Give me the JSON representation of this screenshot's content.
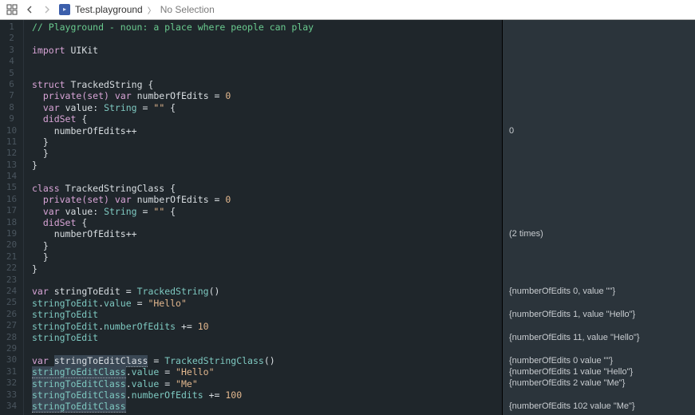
{
  "toolbar": {
    "file": "Test.playground",
    "selection": "No Selection"
  },
  "gutter": {
    "start": 1,
    "end": 34
  },
  "code": [
    {
      "n": 1,
      "tokens": [
        {
          "t": "// Playground - noun: a place where people can play",
          "c": "comment"
        }
      ]
    },
    {
      "n": 2,
      "tokens": []
    },
    {
      "n": 3,
      "tokens": [
        {
          "t": "import",
          "c": "key"
        },
        {
          "t": " "
        },
        {
          "t": "UIKit",
          "c": "id"
        }
      ]
    },
    {
      "n": 4,
      "tokens": []
    },
    {
      "n": 5,
      "tokens": []
    },
    {
      "n": 6,
      "tokens": [
        {
          "t": "struct",
          "c": "key"
        },
        {
          "t": " "
        },
        {
          "t": "TrackedString",
          "c": "id"
        },
        {
          "t": " {",
          "c": "punc"
        }
      ]
    },
    {
      "n": 7,
      "tokens": [
        {
          "t": "  "
        },
        {
          "t": "private(set)",
          "c": "key"
        },
        {
          "t": " "
        },
        {
          "t": "var",
          "c": "key"
        },
        {
          "t": " "
        },
        {
          "t": "numberOfEdits",
          "c": "id"
        },
        {
          "t": " = ",
          "c": "punc"
        },
        {
          "t": "0",
          "c": "num"
        }
      ]
    },
    {
      "n": 8,
      "tokens": [
        {
          "t": "  "
        },
        {
          "t": "var",
          "c": "key"
        },
        {
          "t": " "
        },
        {
          "t": "value",
          "c": "id"
        },
        {
          "t": ": ",
          "c": "punc"
        },
        {
          "t": "String",
          "c": "type"
        },
        {
          "t": " = ",
          "c": "punc"
        },
        {
          "t": "\"\"",
          "c": "str"
        },
        {
          "t": " {",
          "c": "punc"
        }
      ]
    },
    {
      "n": 9,
      "tokens": [
        {
          "t": "  "
        },
        {
          "t": "didSet",
          "c": "key"
        },
        {
          "t": " {",
          "c": "punc"
        }
      ]
    },
    {
      "n": 10,
      "tokens": [
        {
          "t": "    numberOfEdits++",
          "c": "id"
        }
      ]
    },
    {
      "n": 11,
      "tokens": [
        {
          "t": "  }",
          "c": "punc"
        }
      ]
    },
    {
      "n": 12,
      "tokens": [
        {
          "t": "  }",
          "c": "punc"
        }
      ]
    },
    {
      "n": 13,
      "tokens": [
        {
          "t": "}",
          "c": "punc"
        }
      ]
    },
    {
      "n": 14,
      "tokens": []
    },
    {
      "n": 15,
      "tokens": [
        {
          "t": "class",
          "c": "key"
        },
        {
          "t": " "
        },
        {
          "t": "TrackedStringClass",
          "c": "id"
        },
        {
          "t": " {",
          "c": "punc"
        }
      ]
    },
    {
      "n": 16,
      "tokens": [
        {
          "t": "  "
        },
        {
          "t": "private(set)",
          "c": "key"
        },
        {
          "t": " "
        },
        {
          "t": "var",
          "c": "key"
        },
        {
          "t": " "
        },
        {
          "t": "numberOfEdits",
          "c": "id"
        },
        {
          "t": " = ",
          "c": "punc"
        },
        {
          "t": "0",
          "c": "num"
        }
      ]
    },
    {
      "n": 17,
      "tokens": [
        {
          "t": "  "
        },
        {
          "t": "var",
          "c": "key"
        },
        {
          "t": " "
        },
        {
          "t": "value",
          "c": "id"
        },
        {
          "t": ": ",
          "c": "punc"
        },
        {
          "t": "String",
          "c": "type"
        },
        {
          "t": " = ",
          "c": "punc"
        },
        {
          "t": "\"\"",
          "c": "str"
        },
        {
          "t": " {",
          "c": "punc"
        }
      ]
    },
    {
      "n": 18,
      "tokens": [
        {
          "t": "  "
        },
        {
          "t": "didSet",
          "c": "key"
        },
        {
          "t": " {",
          "c": "punc"
        }
      ]
    },
    {
      "n": 19,
      "tokens": [
        {
          "t": "    numberOfEdits++",
          "c": "id"
        }
      ]
    },
    {
      "n": 20,
      "tokens": [
        {
          "t": "  }",
          "c": "punc"
        }
      ]
    },
    {
      "n": 21,
      "tokens": [
        {
          "t": "  }",
          "c": "punc"
        }
      ]
    },
    {
      "n": 22,
      "tokens": [
        {
          "t": "}",
          "c": "punc"
        }
      ]
    },
    {
      "n": 23,
      "tokens": []
    },
    {
      "n": 24,
      "tokens": [
        {
          "t": "var",
          "c": "key"
        },
        {
          "t": " "
        },
        {
          "t": "stringToEdit",
          "c": "id"
        },
        {
          "t": " = ",
          "c": "punc"
        },
        {
          "t": "TrackedString",
          "c": "type"
        },
        {
          "t": "()",
          "c": "punc"
        }
      ]
    },
    {
      "n": 25,
      "tokens": [
        {
          "t": "stringToEdit",
          "c": "type"
        },
        {
          "t": ".",
          "c": "punc"
        },
        {
          "t": "value",
          "c": "type"
        },
        {
          "t": " = ",
          "c": "punc"
        },
        {
          "t": "\"Hello\"",
          "c": "str"
        }
      ]
    },
    {
      "n": 26,
      "tokens": [
        {
          "t": "stringToEdit",
          "c": "type"
        }
      ]
    },
    {
      "n": 27,
      "tokens": [
        {
          "t": "stringToEdit",
          "c": "type"
        },
        {
          "t": ".",
          "c": "punc"
        },
        {
          "t": "numberOfEdits",
          "c": "type"
        },
        {
          "t": " += ",
          "c": "punc"
        },
        {
          "t": "10",
          "c": "num"
        }
      ]
    },
    {
      "n": 28,
      "tokens": [
        {
          "t": "stringToEdit",
          "c": "type"
        }
      ]
    },
    {
      "n": 29,
      "tokens": []
    },
    {
      "n": 30,
      "tokens": [
        {
          "t": "var",
          "c": "key"
        },
        {
          "t": " "
        },
        {
          "t": "stringToEditClass",
          "c": "id",
          "sel": true
        },
        {
          "t": " = ",
          "c": "punc"
        },
        {
          "t": "TrackedStringClass",
          "c": "type"
        },
        {
          "t": "()",
          "c": "punc"
        }
      ]
    },
    {
      "n": 31,
      "tokens": [
        {
          "t": "stringToEditClass",
          "c": "type",
          "sel": true
        },
        {
          "t": ".",
          "c": "punc"
        },
        {
          "t": "value",
          "c": "type"
        },
        {
          "t": " = ",
          "c": "punc"
        },
        {
          "t": "\"Hello\"",
          "c": "str"
        }
      ]
    },
    {
      "n": 32,
      "tokens": [
        {
          "t": "stringToEditClass",
          "c": "type",
          "sel": true
        },
        {
          "t": ".",
          "c": "punc"
        },
        {
          "t": "value",
          "c": "type"
        },
        {
          "t": " = ",
          "c": "punc"
        },
        {
          "t": "\"Me\"",
          "c": "str"
        }
      ]
    },
    {
      "n": 33,
      "tokens": [
        {
          "t": "stringToEditClass",
          "c": "type",
          "sel": true
        },
        {
          "t": ".",
          "c": "punc"
        },
        {
          "t": "numberOfEdits",
          "c": "type"
        },
        {
          "t": " += ",
          "c": "punc"
        },
        {
          "t": "100",
          "c": "num"
        }
      ]
    },
    {
      "n": 34,
      "tokens": [
        {
          "t": "stringToEditClass",
          "c": "type",
          "sel": true
        }
      ]
    }
  ],
  "results": [
    {
      "line": 10,
      "text": "0"
    },
    {
      "line": 19,
      "text": "(2 times)"
    },
    {
      "line": 24,
      "text": "{numberOfEdits 0, value \"\"}"
    },
    {
      "line": 26,
      "text": "{numberOfEdits 1, value \"Hello\"}"
    },
    {
      "line": 28,
      "text": "{numberOfEdits 11, value \"Hello\"}"
    },
    {
      "line": 30,
      "text": "{numberOfEdits 0 value \"\"}"
    },
    {
      "line": 31,
      "text": "{numberOfEdits 1 value \"Hello\"}"
    },
    {
      "line": 32,
      "text": "{numberOfEdits 2 value \"Me\"}"
    },
    {
      "line": 34,
      "text": "{numberOfEdits 102 value \"Me\"}"
    }
  ]
}
